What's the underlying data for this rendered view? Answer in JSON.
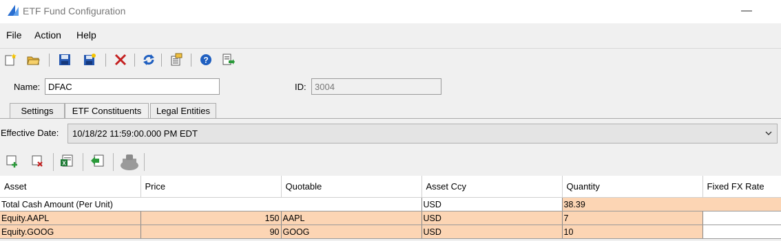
{
  "window": {
    "title": "ETF Fund Configuration",
    "minimize_glyph": "—",
    "icon": "app-logo-icon"
  },
  "menu": {
    "items": [
      "File",
      "Action",
      "Help"
    ]
  },
  "toolbar": {
    "icons": [
      "new-document-icon",
      "open-folder-icon",
      "save-icon",
      "save-as-icon",
      "delete-icon",
      "refresh-icon",
      "properties-icon",
      "help-icon",
      "export-icon"
    ]
  },
  "form": {
    "name_label": "Name:",
    "name_value": "DFAC",
    "id_label": "ID:",
    "id_value": "3004"
  },
  "tabs": [
    {
      "label": "Settings",
      "active": false
    },
    {
      "label": "ETF Constituents",
      "active": true
    },
    {
      "label": "Legal Entities",
      "active": false
    }
  ],
  "effective": {
    "label": "Effective Date:",
    "value": "10/18/22 11:59:00.000 PM EDT"
  },
  "subtoolbar": {
    "icons": [
      "add-row-icon",
      "delete-row-icon",
      "excel-export-icon",
      "import-icon",
      "calculator-icon"
    ]
  },
  "grid": {
    "headers": [
      "Asset",
      "Price",
      "Quotable",
      "Asset Ccy",
      "Quantity",
      "Fixed FX Rate"
    ],
    "rows": [
      {
        "asset": "Total Cash Amount (Per Unit)",
        "price": "",
        "quotable": "",
        "ccy": "USD",
        "quantity": "38.39",
        "fx": ""
      },
      {
        "asset": "Equity.AAPL",
        "price": "150",
        "quotable": "AAPL",
        "ccy": "USD",
        "quantity": "7",
        "fx": ""
      },
      {
        "asset": "Equity.GOOG",
        "price": "90",
        "quotable": "GOOG",
        "ccy": "USD",
        "quantity": "10",
        "fx": ""
      }
    ]
  },
  "colors": {
    "highlight": "#fcd5b4",
    "window_bg": "#f0f0f0"
  }
}
